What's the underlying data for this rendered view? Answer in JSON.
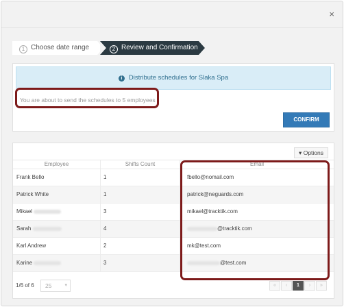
{
  "dialog": {
    "close_glyph": "×"
  },
  "steps": [
    {
      "number": "1",
      "label": "Choose date range"
    },
    {
      "number": "2",
      "label": "Review and Confirmation"
    }
  ],
  "confirm_card": {
    "info_icon": "info-icon",
    "banner_text": "Distribute schedules for Slaka Spa",
    "about_text": "You are about to send the schedules to 5 employees",
    "confirm_label": "CONFIRM",
    "accent_color": "#337ab7",
    "banner_color": "#d9edf7"
  },
  "table": {
    "options_label": "Options",
    "columns": [
      "Employee",
      "Shifts Count",
      "Email"
    ],
    "rows": [
      {
        "employee": "Frank Bello",
        "shifts": "1",
        "email": "fbello@nomail.com"
      },
      {
        "employee": "Patrick White",
        "shifts": "1",
        "email": "patrick@neguards.com"
      },
      {
        "employee": "Mikael",
        "shifts": "3",
        "email": "mikael@tracktik.com"
      },
      {
        "employee": "Sarah",
        "shifts": "4",
        "email": "@tracktik.com"
      },
      {
        "employee": "Karl Andrew",
        "shifts": "2",
        "email": "mk@test.com"
      },
      {
        "employee": "Karine",
        "shifts": "3",
        "email": "@test.com"
      }
    ]
  },
  "footer": {
    "page_info": "1/6 of 6",
    "page_size": "25",
    "pager": [
      "«",
      "‹",
      "1",
      "›",
      "»"
    ],
    "current_page": "1"
  },
  "annotation_color": "#7d1a1a"
}
